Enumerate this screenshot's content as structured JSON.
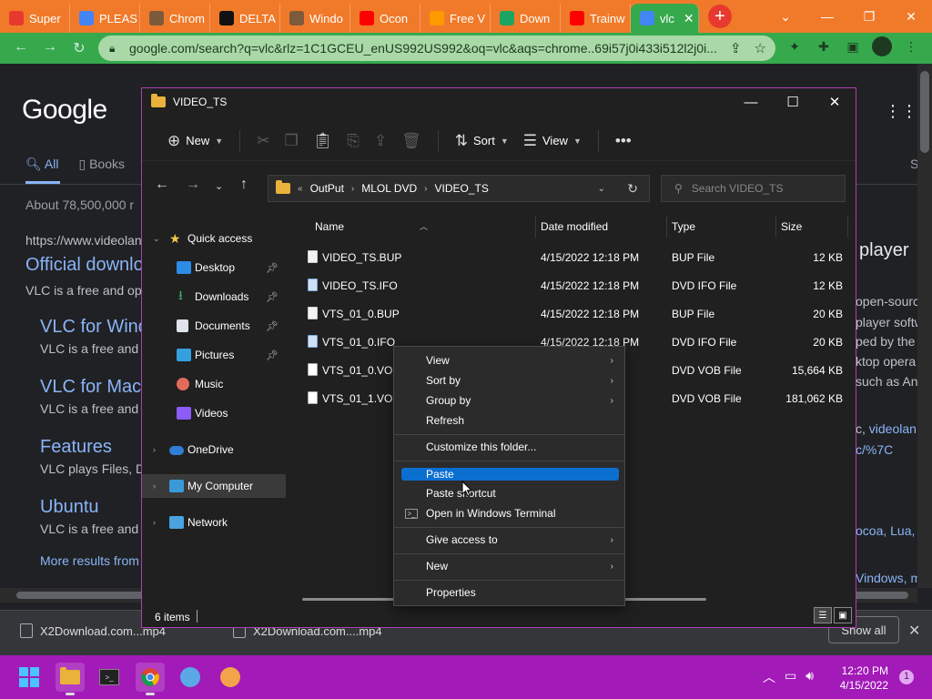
{
  "browser": {
    "tabs": [
      {
        "label": "Super",
        "fav_color": "#e8392e"
      },
      {
        "label": "PLEAS",
        "fav_color": "#4285f4"
      },
      {
        "label": "Chrom",
        "fav_color": "#7d5a3c"
      },
      {
        "label": "DELTA",
        "fav_color": "#111111"
      },
      {
        "label": "Windo",
        "fav_color": "#7d5a3c"
      },
      {
        "label": "Ocon",
        "fav_color": "#ff0000"
      },
      {
        "label": "Free V",
        "fav_color": "#ff9900"
      },
      {
        "label": "Down",
        "fav_color": "#1da462"
      },
      {
        "label": "Trainw",
        "fav_color": "#ff0000"
      },
      {
        "label": "vlc",
        "fav_color": "#4285f4",
        "active": true
      }
    ],
    "url": "google.com/search?q=vlc&rlz=1C1GCEU_enUS992US992&oq=vlc&aqs=chrome..69i57j0i433i512l2j0i..."
  },
  "google": {
    "logo": "Google",
    "tabs": [
      "All",
      "Books"
    ],
    "tab_s": "S",
    "about": "About 78,500,000 r",
    "cite": "https://www.videolan",
    "r1_title": "Official downlo",
    "r1_snip": "VLC is a free and op",
    "s1_title": "VLC for Wind",
    "s1_snip": "VLC is a free and",
    "s2_title": "VLC for Mac",
    "s2_snip": "VLC is a free and",
    "s3_title": "Features",
    "s3_snip": "VLC plays Files, D",
    "s4_title": "Ubuntu",
    "s4_snip": "VLC is a free and",
    "more": "More results from",
    "right": {
      "heading": "player",
      "l1": "open-sourc",
      "l2": "player softw",
      "l3": "ped by the V",
      "l4": "ktop opera",
      "l5": "such as An",
      "l6a": "c, ",
      "l6b": "videolan",
      "l7": "c/%7C",
      "l8": "ocoa, Lua, S",
      "l9": "Vindows, m"
    }
  },
  "downloads": {
    "items": [
      "X2Download.com...mp4",
      "X2Download.com....mp4"
    ],
    "show_all": "Show all"
  },
  "explorer": {
    "title": "VIDEO_TS",
    "commands": {
      "new": "New",
      "sort": "Sort",
      "view": "View"
    },
    "breadcrumb": [
      "OutPut",
      "MLOL DVD",
      "VIDEO_TS"
    ],
    "search_placeholder": "Search VIDEO_TS",
    "nav": {
      "quick_access": "Quick access",
      "desktop": "Desktop",
      "downloads": "Downloads",
      "documents": "Documents",
      "pictures": "Pictures",
      "music": "Music",
      "videos": "Videos",
      "onedrive": "OneDrive",
      "my_computer": "My Computer",
      "network": "Network"
    },
    "columns": {
      "name": "Name",
      "date": "Date modified",
      "type": "Type",
      "size": "Size"
    },
    "files": [
      {
        "name": "VIDEO_TS.BUP",
        "date": "4/15/2022 12:18 PM",
        "type": "BUP File",
        "size": "12 KB",
        "kind": "bup"
      },
      {
        "name": "VIDEO_TS.IFO",
        "date": "4/15/2022 12:18 PM",
        "type": "DVD IFO File",
        "size": "12 KB",
        "kind": "ifo"
      },
      {
        "name": "VTS_01_0.BUP",
        "date": "4/15/2022 12:18 PM",
        "type": "BUP File",
        "size": "20 KB",
        "kind": "bup"
      },
      {
        "name": "VTS_01_0.IFO",
        "date": "4/15/2022 12:18 PM",
        "type": "DVD IFO File",
        "size": "20 KB",
        "kind": "ifo"
      },
      {
        "name": "VTS_01_0.VOB",
        "date": "M",
        "type": "DVD VOB File",
        "size": "15,664 KB",
        "kind": "vob"
      },
      {
        "name": "VTS_01_1.VOB",
        "date": "M",
        "type": "DVD VOB File",
        "size": "181,062 KB",
        "kind": "vob"
      }
    ],
    "status": "6 items"
  },
  "context_menu": {
    "view": "View",
    "sort_by": "Sort by",
    "group_by": "Group by",
    "refresh": "Refresh",
    "customize": "Customize this folder...",
    "paste": "Paste",
    "paste_shortcut": "Paste shortcut",
    "open_terminal": "Open in Windows Terminal",
    "give_access": "Give access to",
    "new": "New",
    "properties": "Properties"
  },
  "taskbar": {
    "time": "12:20 PM",
    "date": "4/15/2022",
    "notifications": "1"
  }
}
